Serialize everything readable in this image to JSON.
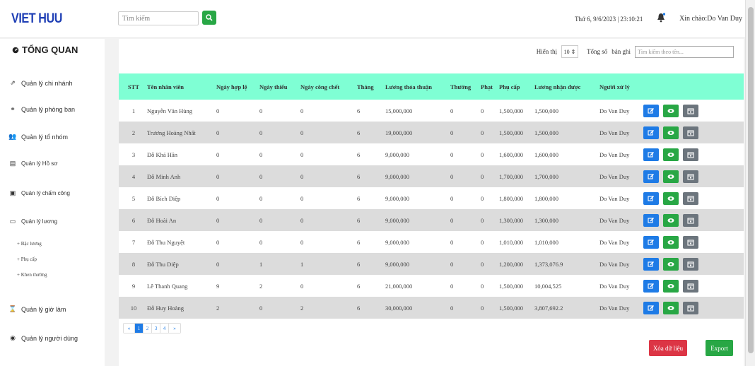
{
  "brand": "VIET HUU",
  "search": {
    "placeholder": "Tìm kiếm"
  },
  "header": {
    "datetime": "Thứ 6, 9/6/2023 | 23:10:21",
    "greeting": "Xin chào:Do Van Duy"
  },
  "sidebar": {
    "overview": "TỔNG QUAN",
    "items": [
      {
        "label": "Quản lý chi nhánh",
        "icon": "branch-icon"
      },
      {
        "label": "Quản lý phòng ban",
        "icon": "department-icon"
      },
      {
        "label": "Quản lý tổ nhóm",
        "icon": "group-icon"
      },
      {
        "label": "Quản lý Hồ sơ",
        "icon": "profile-icon"
      },
      {
        "label": "Quản lý chấm công",
        "icon": "calendar-icon"
      },
      {
        "label": "Quản lý lương",
        "icon": "money-icon"
      },
      {
        "label": "Quản lý giờ làm",
        "icon": "hourglass-icon"
      },
      {
        "label": "Quản lý người dùng",
        "icon": "user-icon"
      }
    ],
    "subitems": [
      "+ Bậc lương",
      "+ Phụ cấp",
      "+ Khen thưởng"
    ]
  },
  "controls": {
    "show_label": "Hiển thị",
    "page_size": "10",
    "total_label": "Tổng số",
    "records_label": "bản ghi",
    "name_search_placeholder": "Tìm kiếm theo tên..."
  },
  "table": {
    "columns": [
      "STT",
      "Tên nhân viên",
      "Ngày hợp lệ",
      "Ngày thiếu",
      "Ngày công chết",
      "Tháng",
      "Lương thỏa thuận",
      "Thưởng",
      "Phạt",
      "Phụ cấp",
      "Lương nhận được",
      "Người xử lý"
    ],
    "rows": [
      [
        "1",
        "Nguyễn Văn Hùng",
        "0",
        "0",
        "0",
        "6",
        "15,000,000",
        "0",
        "0",
        "1,500,000",
        "1,500,000",
        "Do Van Duy"
      ],
      [
        "2",
        "Trương Hoàng Nhất",
        "0",
        "0",
        "0",
        "6",
        "19,000,000",
        "0",
        "0",
        "1,500,000",
        "1,500,000",
        "Do Van Duy"
      ],
      [
        "3",
        "Đỗ Khả Hân",
        "0",
        "0",
        "0",
        "6",
        "9,000,000",
        "0",
        "0",
        "1,600,000",
        "1,600,000",
        "Do Van Duy"
      ],
      [
        "4",
        "Đỗ Minh Anh",
        "0",
        "0",
        "0",
        "6",
        "9,000,000",
        "0",
        "0",
        "1,700,000",
        "1,700,000",
        "Do Van Duy"
      ],
      [
        "5",
        "Đỗ Bích Diệp",
        "0",
        "0",
        "0",
        "6",
        "9,000,000",
        "0",
        "0",
        "1,800,000",
        "1,800,000",
        "Do Van Duy"
      ],
      [
        "6",
        "Đỗ Hoài An",
        "0",
        "0",
        "0",
        "6",
        "9,000,000",
        "0",
        "0",
        "1,300,000",
        "1,300,000",
        "Do Van Duy"
      ],
      [
        "7",
        "Đỗ Thu Nguyệt",
        "0",
        "0",
        "0",
        "6",
        "9,000,000",
        "0",
        "0",
        "1,010,000",
        "1,010,000",
        "Do Van Duy"
      ],
      [
        "8",
        "Đỗ Thu Diệp",
        "0",
        "1",
        "1",
        "6",
        "9,000,000",
        "0",
        "0",
        "1,200,000",
        "1,373,076.9",
        "Do Van Duy"
      ],
      [
        "9",
        "Lê Thanh Quang",
        "9",
        "2",
        "0",
        "6",
        "21,000,000",
        "0",
        "0",
        "1,500,000",
        "10,004,525",
        "Do Van Duy"
      ],
      [
        "10",
        "Đỗ Huy Hoàng",
        "2",
        "0",
        "2",
        "6",
        "30,000,000",
        "0",
        "0",
        "1,500,000",
        "3,807,692.2",
        "Do Van Duy"
      ]
    ]
  },
  "pagination": {
    "prev": "«",
    "pages": [
      "1",
      "2",
      "3",
      "4"
    ],
    "next": "»",
    "active": "1"
  },
  "buttons": {
    "delete": "Xóa dữ liệu",
    "export": "Export"
  },
  "colors": {
    "brand": "#1f3fb5",
    "table_header": "#7fffd4",
    "edit": "#1e7be6",
    "view": "#28a745",
    "calendar": "#6c757d",
    "delete": "#dc3545",
    "export": "#28a745"
  }
}
